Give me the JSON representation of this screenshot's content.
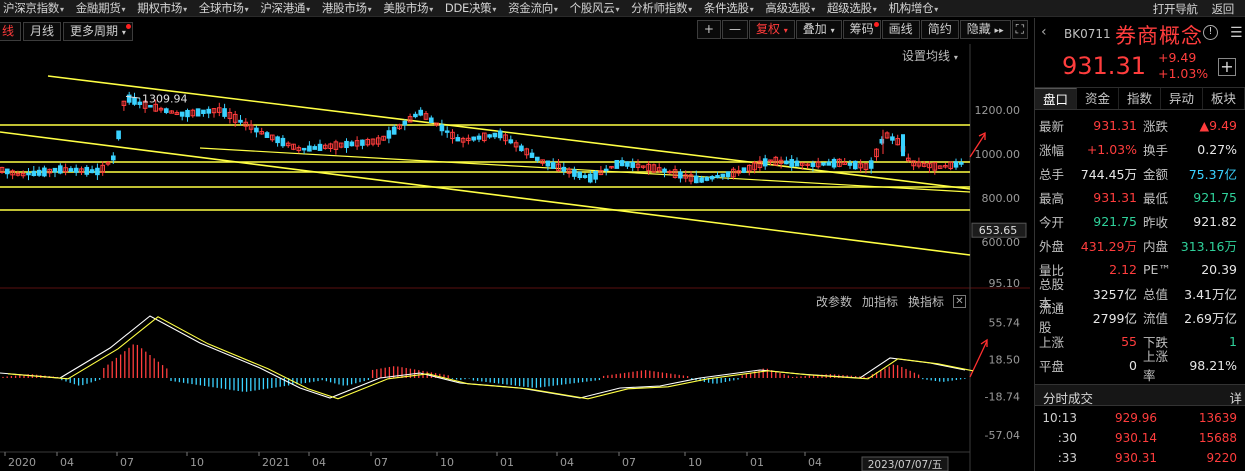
{
  "top_menu": {
    "items": [
      "沪深京指数",
      "金融期货",
      "期权市场",
      "全球市场",
      "沪深港通",
      "港股市场",
      "美股市场",
      "DDE决策",
      "资金流向",
      "个股风云",
      "分析师指数",
      "条件选股",
      "高级选股",
      "超级选股",
      "机构增仓"
    ],
    "right_items": [
      "打开导航",
      "返回"
    ]
  },
  "toolbar": {
    "period_partial": "线",
    "monthly": "月线",
    "more_periods": "更多周期",
    "plus": "+",
    "minus": "—",
    "restore": "复权",
    "overlay": "叠加",
    "chips": "筹码",
    "draw": "画线",
    "simple": "简约",
    "hide": "隐藏",
    "expand_icon": "fullscreen-icon"
  },
  "main_chart": {
    "settings_label": "设置均线",
    "peak_label": "1309.94",
    "axis_labels": [
      "1200.00",
      "1000.00",
      "800.00",
      "653.65",
      "600.00"
    ],
    "current_price_tag": "653.65"
  },
  "macd": {
    "links": [
      "改参数",
      "加指标",
      "换指标"
    ],
    "close_icon": "close-icon",
    "axis_labels": [
      "95.10",
      "55.74",
      "18.50",
      "-18.74",
      "-57.04"
    ]
  },
  "x_axis": {
    "labels": [
      "2020",
      "04",
      "07",
      "10",
      "2021",
      "04",
      "07",
      "10",
      "01",
      "04",
      "07",
      "10",
      "01",
      "04"
    ],
    "date_stamp": "2023/07/07/五"
  },
  "colors": {
    "up": "#ff3d3d",
    "down": "#3ad2ff",
    "trendline": "#ffff44",
    "dif": "#ffffff",
    "dea": "#ffff44"
  },
  "right_panel": {
    "code": "BK0711",
    "name": "券商概念",
    "price": "931.31",
    "change": "+9.49",
    "change_pct": "+1.03%",
    "tabs": [
      "盘口",
      "资金",
      "指数",
      "异动",
      "板块"
    ],
    "rows": [
      {
        "l1": "最新",
        "v1": "931.31",
        "c1": "red",
        "l2": "涨跌",
        "v2": "▲9.49",
        "c2": "red"
      },
      {
        "l1": "涨幅",
        "v1": "+1.03%",
        "c1": "red",
        "l2": "换手",
        "v2": "0.27%",
        "c2": "white"
      },
      {
        "l1": "总手",
        "v1": "744.45万",
        "c1": "white",
        "l2": "金额",
        "v2": "75.37亿",
        "c2": "cyan"
      },
      {
        "l1": "最高",
        "v1": "931.31",
        "c1": "red",
        "l2": "最低",
        "v2": "921.75",
        "c2": "green"
      },
      {
        "l1": "今开",
        "v1": "921.75",
        "c1": "green",
        "l2": "昨收",
        "v2": "921.82",
        "c2": "white"
      },
      {
        "l1": "外盘",
        "v1": "431.29万",
        "c1": "red",
        "l2": "内盘",
        "v2": "313.16万",
        "c2": "green"
      },
      {
        "l1": "量比",
        "v1": "2.12",
        "c1": "red",
        "l2": "PE™",
        "v2": "20.39",
        "c2": "white"
      },
      {
        "l1": "总股本",
        "v1": "3257亿",
        "c1": "white",
        "l2": "总值",
        "v2": "3.41万亿",
        "c2": "white"
      },
      {
        "l1": "流通股",
        "v1": "2799亿",
        "c1": "white",
        "l2": "流值",
        "v2": "2.69万亿",
        "c2": "white"
      },
      {
        "l1": "上涨",
        "v1": "55",
        "c1": "red",
        "l2": "下跌",
        "v2": "1",
        "c2": "green"
      },
      {
        "l1": "平盘",
        "v1": "0",
        "c1": "white",
        "l2": "上涨率",
        "v2": "98.21%",
        "c2": "white"
      }
    ],
    "ticks_title": "分时成交",
    "ticks_detail": "详",
    "ticks": [
      {
        "time": "10:13",
        "price": "929.96",
        "vol": "13639"
      },
      {
        "time": ":30",
        "price": "930.14",
        "vol": "15688"
      },
      {
        "time": ":33",
        "price": "930.31",
        "vol": "9220"
      }
    ]
  }
}
